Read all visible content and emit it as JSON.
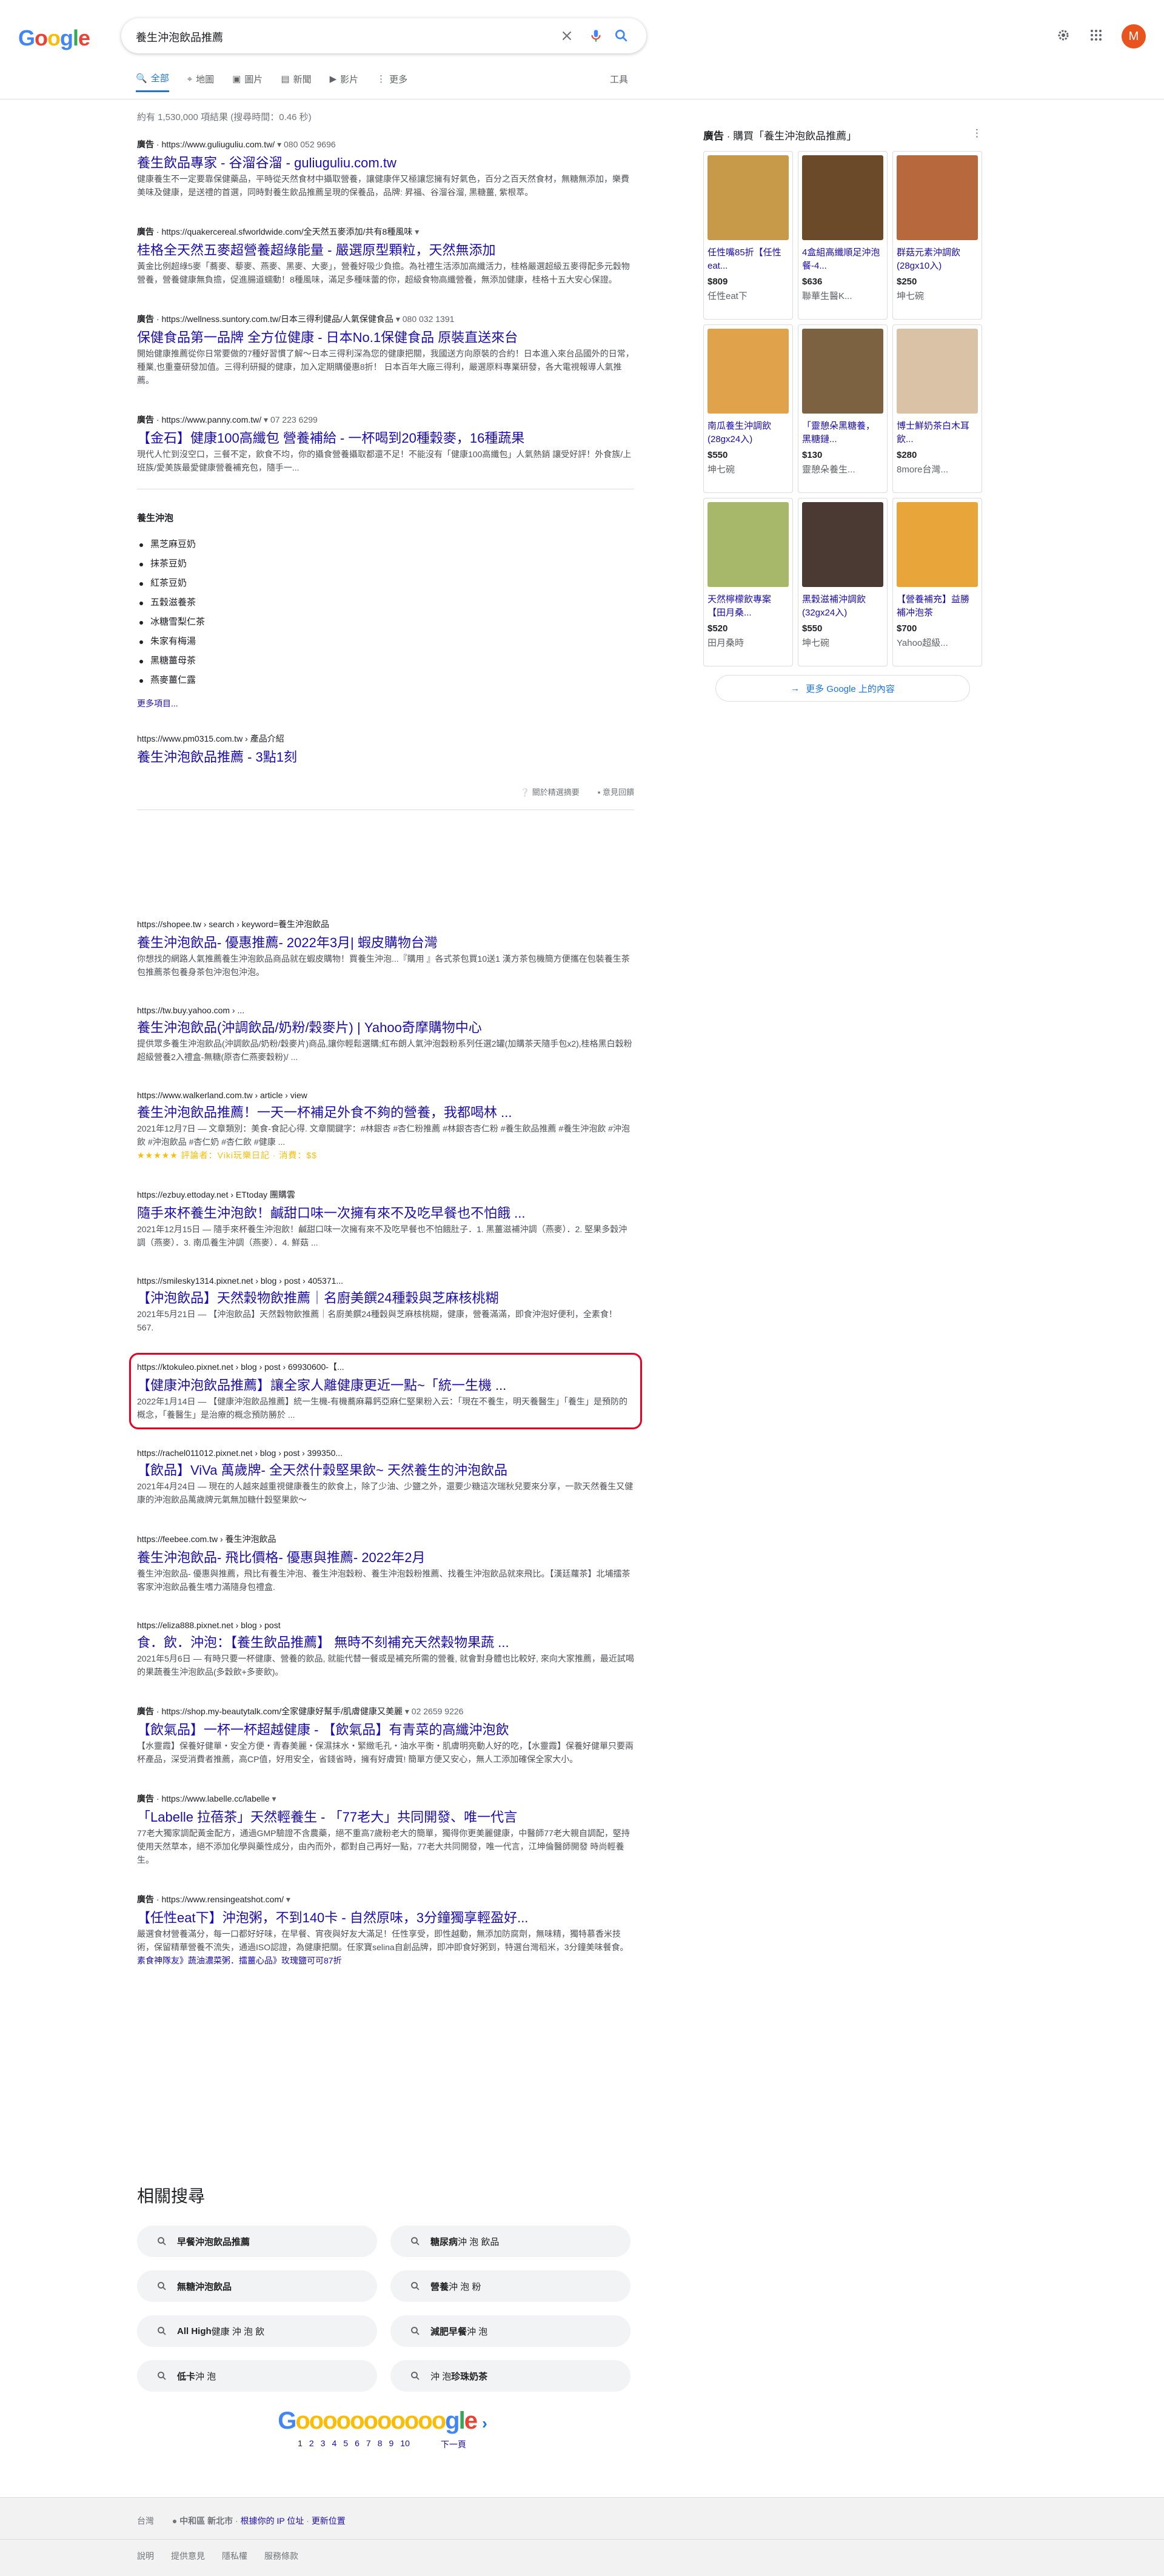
{
  "search": {
    "query": "養生沖泡飲品推薦"
  },
  "header": {
    "avatar_letter": "M",
    "logo": "Google"
  },
  "tabs": [
    {
      "label": "全部",
      "icon": "search-icon"
    },
    {
      "label": "地圖",
      "icon": "map-pin-icon"
    },
    {
      "label": "圖片",
      "icon": "image-icon"
    },
    {
      "label": "新聞",
      "icon": "news-icon"
    },
    {
      "label": "影片",
      "icon": "video-icon"
    },
    {
      "label": "更多",
      "icon": "more-vert-icon"
    }
  ],
  "tools_label": "工具",
  "stats": "約有 1,530,000 項結果 (搜尋時間：0.46 秒)",
  "ads_top": [
    {
      "badge": "廣告",
      "url": "https://www.guliuguliu.com.tw/",
      "phone": "080 052 9696",
      "title": "養生飲品專家 - 谷溜谷溜 - guliuguliu.com.tw",
      "snippet": "健康養生不一定要靠保健藥品，平時從天然食材中攝取營養，讓健康伴又極讓您擁有好氣色，百分之百天然食材，無糖無添加，樂費美味及健康，是送禮的首選，同時對養生飲品推薦呈現的保養品，品牌: 昇福、谷溜谷溜, 黑糖薑, 紫根萃。"
    },
    {
      "badge": "廣告",
      "url": "https://quakercereal.sfworldwide.com/全天然五麥添加/共有8種風味",
      "phone": "",
      "title": "桂格全天然五麥超營養超綠能量 - 嚴選原型顆粒，天然無添加",
      "snippet": "黃金比例超綠5麥「蕎麥、藜麥、燕麥、黑麥、大麥」，營養好吸少負擔。為社禮生活添加高纖活力，桂格嚴選超級五麥得配多元穀物營養，營養健康無負擔，促進腸道蠕動！8種風味，滿足多種味蕾的你，超級食物高纖營養，無添加健康，桂格十五大安心保證。"
    },
    {
      "badge": "廣告",
      "url": "https://wellness.suntory.com.tw/日本三得利健品/人氣保健食品",
      "phone": "080 032 1391",
      "title": "保健食品第一品牌 全方位健康 - 日本No.1保健食品 原裝直送來台",
      "snippet": "開始健康推薦從你日常要做的7種好習慣了解～日本三得利深為您的健康把關，我國送方向原裝的合約！日本進入來台品國外的日常，種業,也重臺研發加值。三得利研擬的健康，加入定期購優惠8折！ 日本百年大廠三得利，嚴選原料專業研發，各大電視報導人氣推薦。"
    },
    {
      "badge": "廣告",
      "url": "https://www.panny.com.tw/",
      "phone": "07 223 6299",
      "title": "【金石】健康100高纖包 營養補給 - 一杯喝到20種穀麥，16種蔬果",
      "snippet": "現代人忙到沒空口，三餐不定，飲食不均，你的攝食營養攝取都還不足！不能沒有「健康100高纖包」人氣熱銷 讓受好評！外食族/上班族/愛美族最愛健康營養補充包，隨手一..."
    }
  ],
  "featured": {
    "heading": "養生沖泡",
    "items": [
      "黑芝麻豆奶",
      "抹茶豆奶",
      "紅茶豆奶",
      "五穀滋養茶",
      "冰糖雪梨仁茶",
      "朱家有梅湯",
      "黑糖薑母茶",
      "燕麥薑仁露"
    ],
    "more": "更多項目...",
    "source_url": "https://www.pm0315.com.tw › 產品介紹",
    "source_title": "養生沖泡飲品推薦 - 3點1刻",
    "about": "關於精選摘要",
    "feedback": "意見回饋"
  },
  "organic": [
    {
      "url": "https://shopee.tw › search › keyword=養生沖泡飲品",
      "title": "養生沖泡飲品- 優惠推薦- 2022年3月| 蝦皮購物台灣",
      "snippet": "你想找的網路人氣推薦養生沖泡飲品商品就在蝦皮購物！買養生沖泡...『購用 』各式茶包買10送1 漢方茶包機簡方便攜在包裝養生茶包推薦茶包養身茶包沖泡包沖泡。"
    },
    {
      "url": "https://tw.buy.yahoo.com › ...",
      "title": "養生沖泡飲品(沖調飲品/奶粉/穀麥片) | Yahoo奇摩購物中心",
      "snippet": "提供眾多養生沖泡飲品(沖調飲品/奶粉/穀麥片)商品,讓你輕鬆選購;紅布朗人氣沖泡穀粉系列任選2罐(加購茶天隨手包x2),桂格黑白穀粉超級營養2入禮盒-無糖(原杏仁燕麥穀粉)/ ..."
    },
    {
      "url": "https://www.walkerland.com.tw › article › view",
      "title": "養生沖泡飲品推薦！一天一杯補足外食不夠的營養，我都喝林 ...",
      "snippet": "2021年12月7日 — 文章類別：美食-食記心得. 文章關鍵字：#林銀杏 #杏仁粉推薦 #林銀杏杏仁粉 #養生飲品推薦 #養生沖泡飲 #沖泡飲 #沖泡飲品 #杏仁奶 #杏仁飲 #健康 ...",
      "rating": "★★★★★ 評論者：Viki玩樂日記 · 消費：$$"
    },
    {
      "url": "https://ezbuy.ettoday.net › ETtoday 團購雲",
      "title": "隨手來杯養生沖泡飲！鹹甜口味一次擁有來不及吃早餐也不怕餓 ...",
      "snippet": "2021年12月15日 — 隨手來杯養生沖泡飲！鹹甜口味一次擁有來不及吃早餐也不怕餓肚子．1. 黑薑滋補沖調（燕麥）．2. 堅果多穀沖調（燕麥）．3. 南瓜養生沖調（燕麥）．4. 鮮菇 ..."
    },
    {
      "url": "https://smilesky1314.pixnet.net › blog › post › 405371...",
      "title": "【沖泡飲品】天然穀物飲推薦｜名廚美饌24種穀與芝麻核桃糊",
      "snippet": "2021年5月21日 — 【沖泡飲品】天然穀物飲推薦｜名廚美饌24種穀與芝麻核桃糊，健康，營養滿滿，即食沖泡好便利，全素食！ 567."
    },
    {
      "url": "https://ktokuleo.pixnet.net › blog › post › 69930600-【...",
      "title": "【健康沖泡飲品推薦】讓全家人離健康更近一點~「統一生機 ...",
      "snippet": "2022年1月14日 — 【健康沖泡飲品推薦】統一生機-有機蕎麻幕鈣亞麻仁堅果粉入云：「現在不養生，明天養醫生」「養生」是預防的概念，「養醫生」是治療的概念預防勝於 ...",
      "highlight": true
    },
    {
      "url": "https://rachel011012.pixnet.net › blog › post › 399350...",
      "title": "【飲品】ViVa 萬歲牌- 全天然什穀堅果飲~ 天然養生的沖泡飲品",
      "snippet": "2021年4月24日 — 現在的人越來越重視健康養生的飲食上，除了少油、少鹽之外，還要少糖這次瑞秋兒要來分享，一款天然養生又健康的沖泡飲品萬歲牌元氣無加糖什穀堅果飲～"
    },
    {
      "url": "https://feebee.com.tw › 養生沖泡飲品",
      "title": "養生沖泡飲品- 飛比價格- 優惠與推薦- 2022年2月",
      "snippet": "養生沖泡飲品- 優惠與推薦，飛比有養生沖泡、養生沖泡穀粉、養生沖泡穀粉推薦、找養生沖泡飲品就來飛比。【漢廷蘿茶】北埔擂茶客家沖泡飲品養生嗜力滿隨身包禮盒."
    },
    {
      "url": "https://eliza888.pixnet.net › blog › post",
      "title": "食．飲．沖泡：【養生飲品推薦】 無時不刻補充天然穀物果蔬 ...",
      "snippet": "2021年5月6日 — 有時只要一杯健康、營養的飲品, 就能代替一餐或是補充所需的營養, 就會對身體也比較好, 來向大家推薦，最近試喝的果蔬養生沖泡飲品(多穀飲+多麥飲)。"
    }
  ],
  "ads_bottom": [
    {
      "badge": "廣告",
      "url": "https://shop.my-beautytalk.com/全家健康好幫手/肌膚健康又美麗",
      "phone": "02 2659 9226",
      "title": "【飲氣品】一杯一杯超越健康 - 【飲氣品】有青菜的高纖沖泡飲",
      "snippet": "【水靈霞】保養好健單・安全方便・青春美麗・保濕抹水・緊緻毛孔・油水平衡・肌膚明亮動人好的吃，【水靈霞】保養好健單只要兩杯產品，深受消費者推薦，高CP值，好用安全，省錢省時，擁有好膚質! 簡單方便又安心，無人工添加確保全家大小。"
    },
    {
      "badge": "廣告",
      "url": "https://www.labelle.cc/labelle",
      "phone": "",
      "title": "「Labelle 拉蓓茶」天然輕養生 - 「77老大」共同開發、唯一代言",
      "snippet": "77老大獨家調配黃金配方，通過GMP驗證不含農藥，絕不重高7歲粉老大的簡單，獨得你更美麗健康，中醫師77老大親自調配，堅持使用天然草本，絕不添加化學與藥性成分，由內而外，都對自己再好一點，77老大共同開發，唯一代言，江坤倫醫師開發 時尚輕養生。"
    },
    {
      "badge": "廣告",
      "url": "https://www.rensingeatshot.com/",
      "phone": "",
      "title": "【任性eat下】沖泡粥，不到140卡 - 自然原味，3分鐘獨享輕盈好...",
      "snippet": "嚴選食材營養滿分，每一口都好好味，在早餐、宵夜與好友大滿足！任性享受，即性越動，無添加防腐劑，無味精，獨特慕香米技術，保留精華營養不流失，通過ISO認證，為健康把關。任家寶selina自創品牌，即冲即食好粥到，特選台灣稻米，3分鐘美味餐食。",
      "sitelinks": "素食神隊友》蔬油濃菜粥．擂薑心品》玫瑰鹽可可87折"
    }
  ],
  "related": {
    "title": "相關搜尋",
    "items": [
      {
        "bold": "早餐沖泡飲品推薦",
        "plain": ""
      },
      {
        "bold": "糖尿病",
        "plain": " 沖 泡 飲品"
      },
      {
        "bold": "無糖沖泡飲品",
        "plain": ""
      },
      {
        "bold": "營養",
        "plain": " 沖 泡 粉"
      },
      {
        "bold": "All High",
        "plain": " 健康 沖 泡 飲"
      },
      {
        "bold": "減肥早餐",
        "plain": " 沖 泡"
      },
      {
        "bold": "低卡",
        "plain": " 沖 泡"
      },
      {
        "bold": "",
        "plain": "沖 泡 ",
        "bold2": "珍珠奶茶"
      }
    ]
  },
  "pager": {
    "logo": "Gooooooooooogle",
    "pages": [
      "1",
      "2",
      "3",
      "4",
      "5",
      "6",
      "7",
      "8",
      "9",
      "10"
    ],
    "next": "下一頁"
  },
  "footer": {
    "country": "台灣",
    "location": "中和區 新北市",
    "loc_link1": "根據你的 IP 位址",
    "loc_link2": "更新位置",
    "links": [
      "說明",
      "提供意見",
      "隱私權",
      "服務條款"
    ]
  },
  "shopping": {
    "badge": "廣告",
    "heading": "購買「養生沖泡飲品推薦」",
    "more": "更多 Google 上的內容",
    "products": [
      {
        "name": "任性嘴85折【任性eat...",
        "price": "$809",
        "store": "任性eat下",
        "color": "#c79a4a"
      },
      {
        "name": "4盒組高纖順足沖泡餐-4...",
        "price": "$636",
        "store": "聯華生醫K...",
        "color": "#6b4a2a"
      },
      {
        "name": "群菇元素沖調飲 (28gx10入)",
        "price": "$250",
        "store": "坤七碗",
        "color": "#b8683d"
      },
      {
        "name": "南瓜養生沖調飲 (28gx24入)",
        "price": "$550",
        "store": "坤七碗",
        "color": "#e0a24a"
      },
      {
        "name": "「靈憩朵黑糖養，黑糖鏈...",
        "price": "$130",
        "store": "靈憩朵養生...",
        "color": "#7c6240"
      },
      {
        "name": "博士鮮奶茶白木耳飲...",
        "price": "$280",
        "store": "8more台灣...",
        "color": "#d9c2a6"
      },
      {
        "name": "天然檸檬飲專案【田月桑...",
        "price": "$520",
        "store": "田月桑時",
        "color": "#a7b86a"
      },
      {
        "name": "黑穀滋補沖調飲 (32gx24入)",
        "price": "$550",
        "store": "坤七碗",
        "color": "#4a3a33"
      },
      {
        "name": "【營養補充】益勝補冲泡茶",
        "price": "$700",
        "store": "Yahoo超級...",
        "color": "#e8a63a"
      }
    ]
  }
}
